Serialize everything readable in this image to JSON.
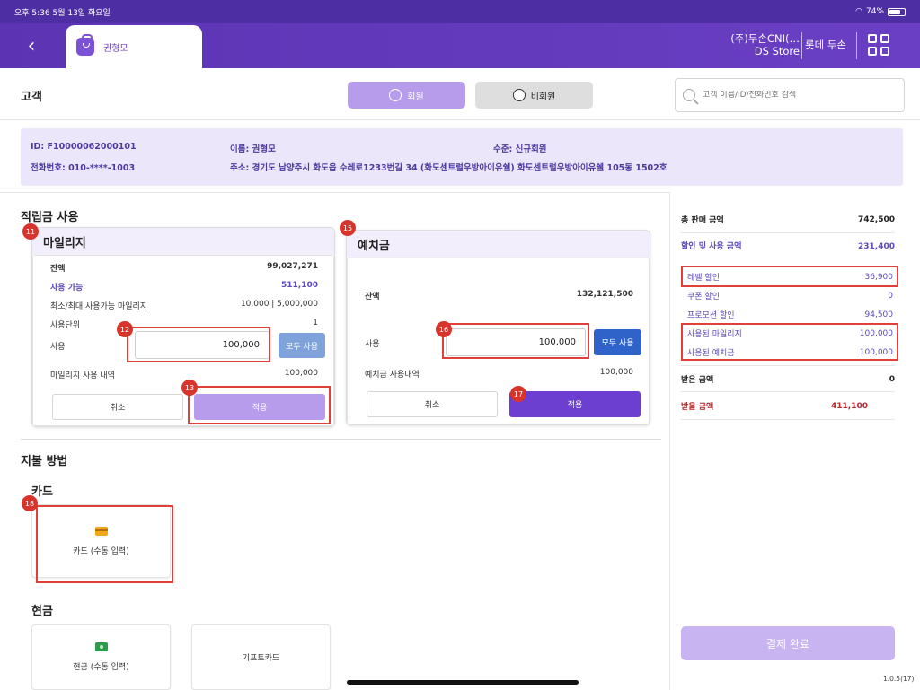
{
  "status_bar": {
    "time_date": "오후 5:36  5월 13일 화요일",
    "battery": "74%",
    "battery_level": 0.74
  },
  "header": {
    "active_tab": "권형모",
    "company_line1": "(주)두손CNI(…",
    "company_line2": "DS Store",
    "store": "롯데 두손"
  },
  "customer": {
    "title": "고객",
    "member_label": "회원",
    "non_member_label": "비회원",
    "search_placeholder": "고객 이름/ID/전화번호 검색",
    "id": "ID: F10000062000101",
    "name": "이름: 권형모",
    "level": "수준: 신규회원",
    "phone": "전화번호: 010-****-1003",
    "address": "주소: 경기도 남양주시 화도읍 수레로1233번길 34  (화도센트럴우방아이유쉘) 화도센트럴우방아이유쉘 105동 1502호"
  },
  "points": {
    "section_title": "적립금 사용",
    "mileage": {
      "title": "마일리지",
      "balance_label": "잔액",
      "balance": "99,027,271",
      "available_label": "사용 가능",
      "available": "511,100",
      "minmax_label": "최소/최대 사용가능 마일리지",
      "minmax": "10,000 | 5,000,000",
      "unit_label": "사용단위",
      "unit": "1",
      "use_label": "사용",
      "use_value": "100,000",
      "use_all": "모두 사용",
      "history_label": "마일리지 사용 내역",
      "history": "100,000",
      "cancel": "취소",
      "apply": "적용"
    },
    "deposit": {
      "title": "예치금",
      "balance_label": "잔액",
      "balance": "132,121,500",
      "use_label": "사용",
      "use_value": "100,000",
      "use_all": "모두 사용",
      "history_label": "예치금 사용내역",
      "history": "100,000",
      "cancel": "취소",
      "apply": "적용"
    }
  },
  "badges": {
    "b11": "11",
    "b12": "12",
    "b13": "13",
    "b15": "15",
    "b16": "16",
    "b17": "17",
    "b18": "18"
  },
  "payment": {
    "title": "지불 방법",
    "card_title": "카드",
    "card_manual": "카드 (수동 입력)",
    "cash_title": "현금",
    "cash_manual": "현금 (수동 입력)",
    "gift_card": "기프트카드"
  },
  "summary": {
    "total_label": "총 판매 금액",
    "total": "742,500",
    "discount_label": "할인 및 사용 금액",
    "discount": "231,400",
    "level_discount_label": "레벨 할인",
    "level_discount": "36,900",
    "coupon_label": "쿠폰 할인",
    "coupon": "0",
    "promo_label": "프로모션 할인",
    "promo": "94,500",
    "mileage_used_label": "사용된 마일리지",
    "mileage_used": "100,000",
    "deposit_used_label": "사용된 예치금",
    "deposit_used": "100,000",
    "received_label": "받은 금액",
    "received": "0",
    "to_receive_label": "받을 금액",
    "to_receive": "411,100",
    "complete": "결제 완료",
    "version": "1.0.5(17)"
  },
  "colors": {
    "brand": "#5c34b3",
    "accent_red": "#d9342b",
    "info_bg": "#ece6fa",
    "blue_btn": "#2f63c9"
  }
}
